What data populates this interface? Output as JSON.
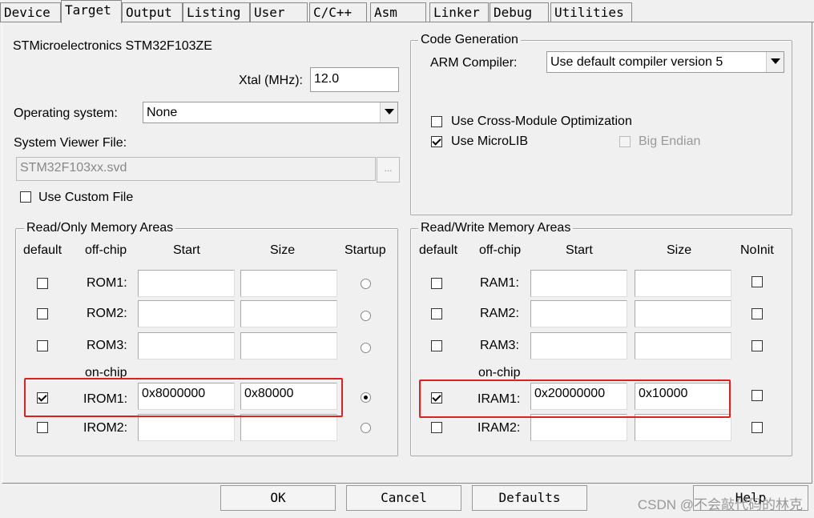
{
  "tabs": [
    "Device",
    "Target",
    "Output",
    "Listing",
    "User",
    "C/C++",
    "Asm",
    "Linker",
    "Debug",
    "Utilities"
  ],
  "active_tab": "Target",
  "device_name": "STMicroelectronics STM32F103ZE",
  "xtal": {
    "label": "Xtal (MHz):",
    "value": "12.0"
  },
  "os": {
    "label": "Operating system:",
    "value": "None"
  },
  "svf": {
    "label": "System Viewer File:",
    "value": "STM32F103xx.svd",
    "browse": "..."
  },
  "custom_file": {
    "label": "Use Custom File",
    "checked": false
  },
  "codegen": {
    "title": "Code Generation",
    "compiler_label": "ARM Compiler:",
    "compiler_value": "Use default compiler version 5",
    "cross_module": {
      "label": "Use Cross-Module Optimization",
      "checked": false
    },
    "microlib": {
      "label": "Use MicroLIB",
      "checked": true
    },
    "big_endian": {
      "label": "Big Endian",
      "checked": false
    }
  },
  "rom": {
    "title": "Read/Only Memory Areas",
    "headers": {
      "default": "default",
      "offchip": "off-chip",
      "start": "Start",
      "size": "Size",
      "startup": "Startup"
    },
    "onchip_label": "on-chip",
    "rows": [
      {
        "name": "ROM1:",
        "start": "",
        "size": "",
        "default": false,
        "startup": false
      },
      {
        "name": "ROM2:",
        "start": "",
        "size": "",
        "default": false,
        "startup": false
      },
      {
        "name": "ROM3:",
        "start": "",
        "size": "",
        "default": false,
        "startup": false
      },
      {
        "name": "IROM1:",
        "start": "0x8000000",
        "size": "0x80000",
        "default": true,
        "startup": true
      },
      {
        "name": "IROM2:",
        "start": "",
        "size": "",
        "default": false,
        "startup": false
      }
    ]
  },
  "ram": {
    "title": "Read/Write Memory Areas",
    "headers": {
      "default": "default",
      "offchip": "off-chip",
      "start": "Start",
      "size": "Size",
      "noinit": "NoInit"
    },
    "onchip_label": "on-chip",
    "rows": [
      {
        "name": "RAM1:",
        "start": "",
        "size": "",
        "default": false,
        "noinit": false
      },
      {
        "name": "RAM2:",
        "start": "",
        "size": "",
        "default": false,
        "noinit": false
      },
      {
        "name": "RAM3:",
        "start": "",
        "size": "",
        "default": false,
        "noinit": false
      },
      {
        "name": "IRAM1:",
        "start": "0x20000000",
        "size": "0x10000",
        "default": true,
        "noinit": false
      },
      {
        "name": "IRAM2:",
        "start": "",
        "size": "",
        "default": false,
        "noinit": false
      }
    ]
  },
  "buttons": {
    "ok": "OK",
    "cancel": "Cancel",
    "defaults": "Defaults",
    "help": "Help"
  },
  "watermark": "CSDN @不会敲代码的林克",
  "colors": {
    "highlight": "#e02020"
  }
}
